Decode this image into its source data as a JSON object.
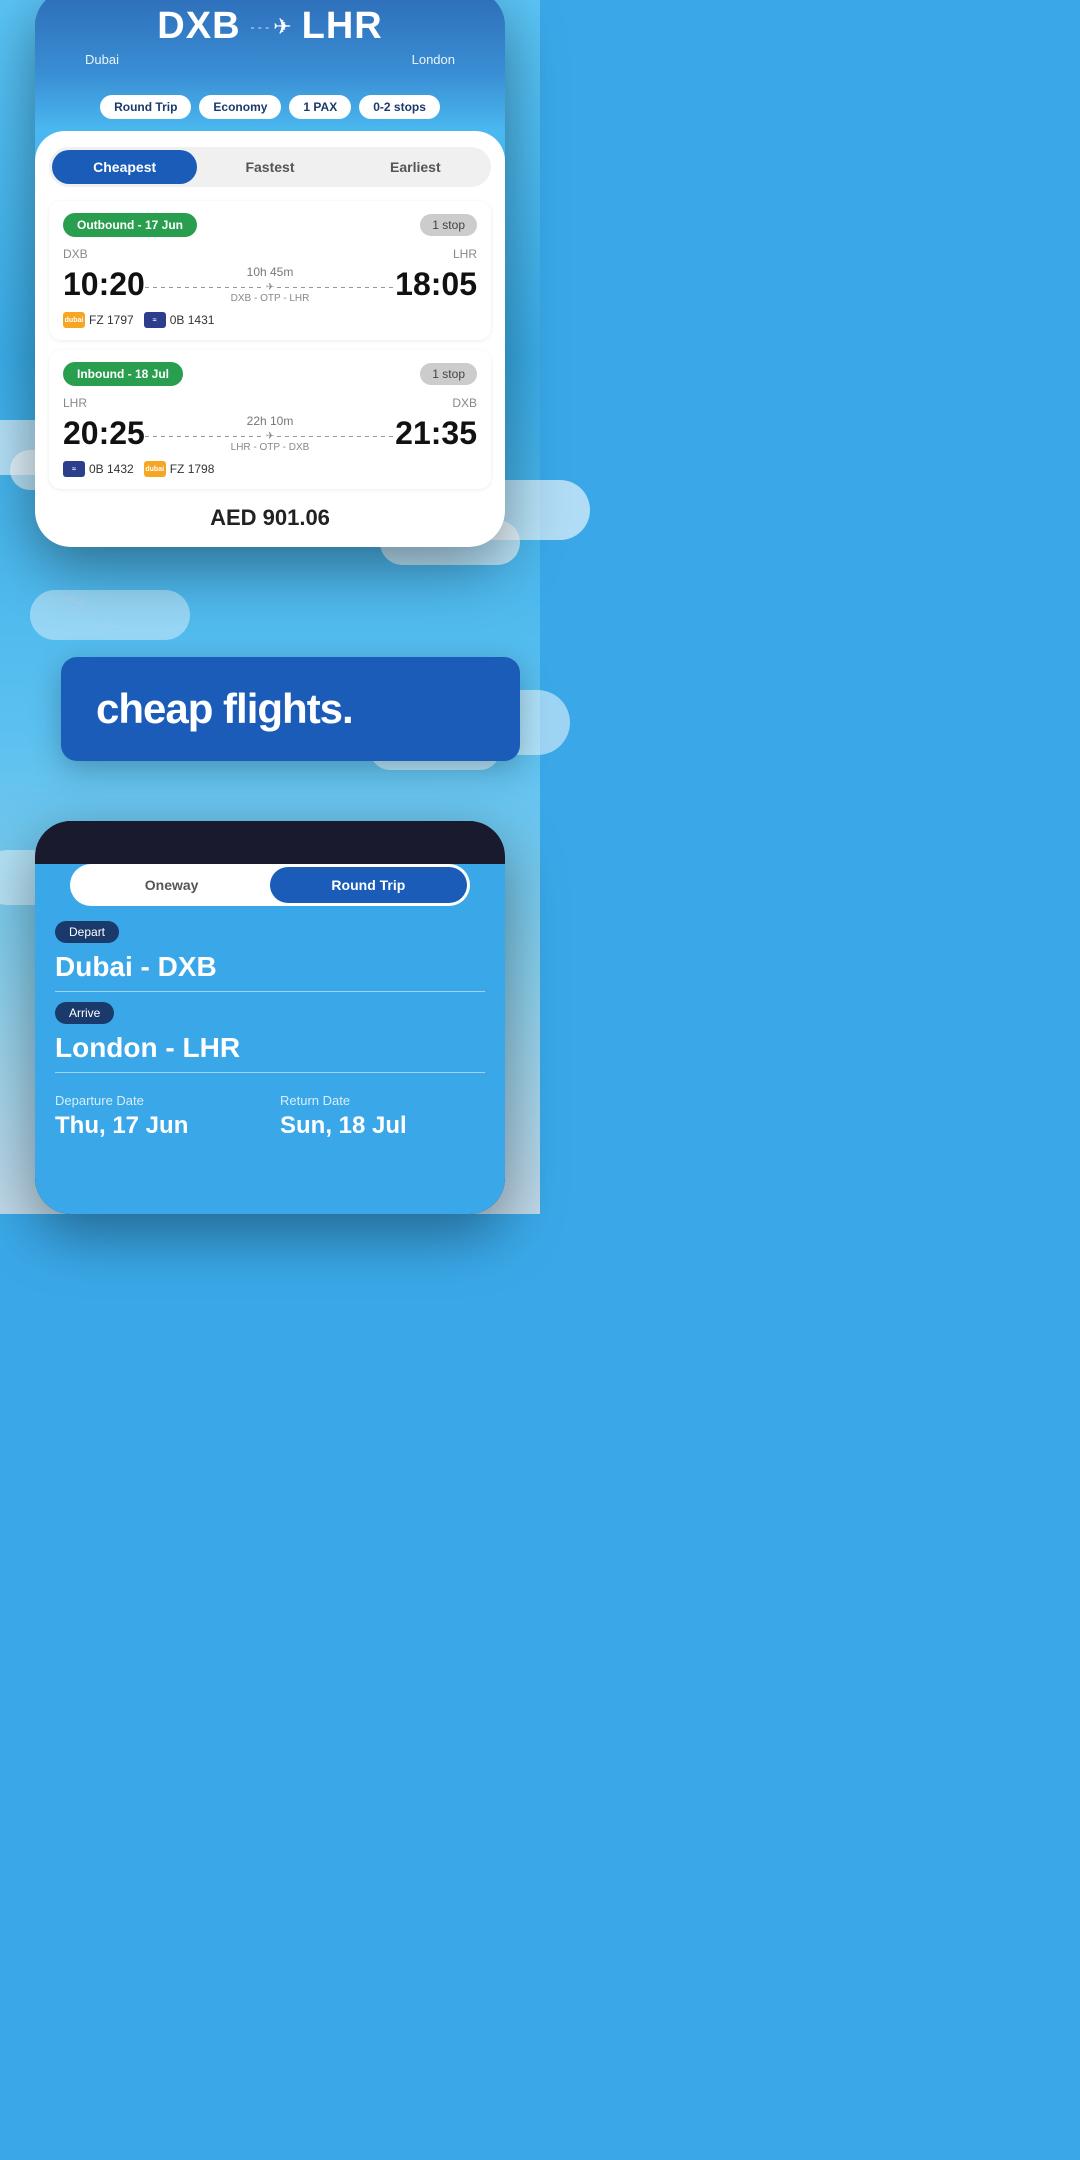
{
  "header": {
    "departure_code": "DXB",
    "departure_city": "Dubai",
    "arrival_code": "LHR",
    "arrival_city": "London",
    "trip_type": "Round Trip",
    "cabin_class": "Economy",
    "passengers": "1 PAX",
    "stops": "0-2 stops",
    "flight_icon": "✈"
  },
  "tabs": {
    "cheapest_label": "Cheapest",
    "fastest_label": "Fastest",
    "earliest_label": "Earliest"
  },
  "outbound": {
    "label": "Outbound - 17 Jun",
    "stops_badge": "1 stop",
    "origin": "DXB",
    "destination": "LHR",
    "depart_time": "10:20",
    "arrive_time": "18:05",
    "duration": "10h 45m",
    "via": "DXB - OTP - LHR",
    "airline1_code": "FZ 1797",
    "airline1_name": "flydubai",
    "airline2_code": "0B 1431",
    "airline2_name": "Blue Air"
  },
  "inbound": {
    "label": "Inbound - 18 Jul",
    "stops_badge": "1 stop",
    "origin": "LHR",
    "destination": "DXB",
    "depart_time": "20:25",
    "arrive_time": "21:35",
    "duration": "22h 10m",
    "via": "LHR - OTP - DXB",
    "airline1_code": "0B 1432",
    "airline1_name": "Blue Air",
    "airline2_code": "FZ 1798",
    "airline2_name": "flydubai"
  },
  "price_peek": "AED 901.06",
  "promo": {
    "text": "cheap flights."
  },
  "search": {
    "trip_oneway": "Oneway",
    "trip_roundtrip": "Round Trip",
    "depart_label": "Depart",
    "depart_value": "Dubai - DXB",
    "arrive_label": "Arrive",
    "arrive_value": "London - LHR",
    "departure_date_label": "Departure Date",
    "departure_date_value": "Thu, 17 Jun",
    "return_date_label": "Return Date",
    "return_date_value": "Sun, 18 Jul"
  }
}
